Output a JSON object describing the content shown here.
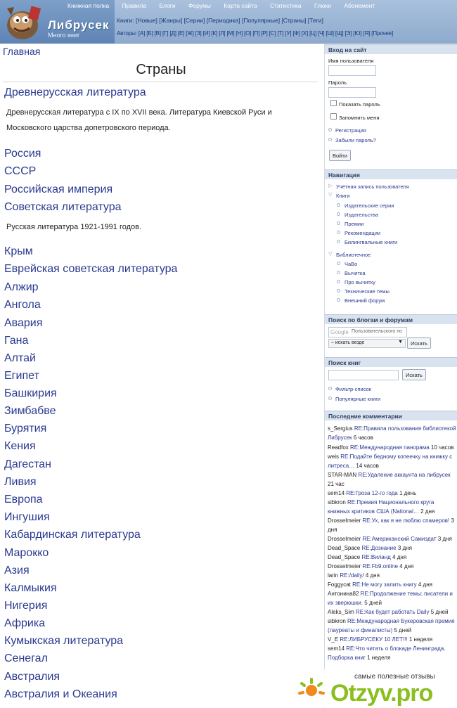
{
  "header": {
    "site_name": "Либрусек",
    "slogan": "Много книг",
    "primary_links": [
      "Книжная полка",
      "Правила",
      "Блоги",
      "Форумы",
      "Карта сайта",
      "Статистика",
      "Глюки",
      "Абонемент"
    ],
    "books_row": "Книги: [Новые] [Жанры] [Серии] [Периодика] [Популярные] [Страны] [Теги]",
    "authors_row": "Авторы: [А] [Б] [В] [Г] [Д] [Е] [Ж] [З] [И] [К] [Л] [М] [Н] [О] [П] [Р] [С] [Т] [У] [Ф] [Х] [Ц] [Ч] [Ш] [Щ] [Э] [Ю] [Я] [Прочее]"
  },
  "main": {
    "breadcrumb": "Главная",
    "title": "Страны",
    "items": [
      {
        "name": "Древнерусская литература"
      },
      {
        "desc": "Древнерусская литература с IX по XVII века. Литература Киевской Руси и Московского царства допетровского периода."
      },
      {
        "name": "Россия"
      },
      {
        "name": "СССР"
      },
      {
        "name": "Российская империя"
      },
      {
        "name": "Советская литература"
      },
      {
        "desc": "Русская литература 1921-1991 годов."
      },
      {
        "name": "Крым"
      },
      {
        "name": "Еврейская советская литература"
      },
      {
        "name": "Алжир"
      },
      {
        "name": "Ангола"
      },
      {
        "name": "Авария"
      },
      {
        "name": "Гана"
      },
      {
        "name": "Алтай"
      },
      {
        "name": "Египет"
      },
      {
        "name": "Башкирия"
      },
      {
        "name": "Зимбабве"
      },
      {
        "name": "Бурятия"
      },
      {
        "name": "Кения"
      },
      {
        "name": "Дагестан"
      },
      {
        "name": "Ливия"
      },
      {
        "name": "Европа"
      },
      {
        "name": "Ингушия"
      },
      {
        "name": "Кабардинская литература"
      },
      {
        "name": "Марокко"
      },
      {
        "name": "Азия"
      },
      {
        "name": "Калмыкия"
      },
      {
        "name": "Нигерия"
      },
      {
        "name": "Африка"
      },
      {
        "name": "Кумыкская литература"
      },
      {
        "name": "Сенегал"
      },
      {
        "name": "Австралия"
      },
      {
        "name": "Австралия и Океания"
      }
    ]
  },
  "sidebar": {
    "login": {
      "heading": "Вход на сайт",
      "username_label": "Имя пользователя",
      "password_label": "Пароль",
      "show_password": "Показать пароль",
      "remember_me": "Запомнить меня",
      "register": "Регистрация",
      "forgot": "Забыли пароль?",
      "submit": "Войти"
    },
    "navigation": {
      "heading": "Навигация",
      "account": "Учётная запись пользователя",
      "books": "Книги",
      "books_children": [
        "Издательские серии",
        "Издательства",
        "Премии",
        "Рекомендации",
        "Билингвальные книги"
      ],
      "library": "Библиотечное",
      "library_children": [
        "ЧаВо",
        "Вычитка",
        "Про вычитку",
        "Технические темы",
        "Внешний форум"
      ]
    },
    "blog_search": {
      "heading": "Поиск по блогам и форумам",
      "google_label": "Google",
      "placeholder": "Пользовательского по",
      "scope": "– искать везде",
      "submit": "Искать"
    },
    "book_search": {
      "heading": "Поиск книг",
      "submit": "Искать",
      "filter_list": "Фильтр-список",
      "popular": "Популярные книги"
    },
    "comments": {
      "heading": "Последние комментарии",
      "items": [
        {
          "user": "s_Sergius",
          "link": "RE:Правила пользования библиотекой Либрусек",
          "time": "6 часов"
        },
        {
          "user": "Readfox",
          "link": "RE:Международная панорама",
          "time": "10 часов"
        },
        {
          "user": "weis",
          "link": "RE:Подайте бедному копеечку на книжку с литреса…",
          "time": "14 часов"
        },
        {
          "user": "STAR-MAN",
          "link": "RE:Удаление аккаунта на либрусек",
          "time": "21 час"
        },
        {
          "user": "sem14",
          "link": "RE:Гроза 12-го года",
          "time": "1 день"
        },
        {
          "user": "sibkron",
          "link": "RE:Премия Национального круга книжных критиков США (National…",
          "time": "2 дня"
        },
        {
          "user": "Drosselmeier",
          "link": "RE:Ух, как я не люблю спамеров!",
          "time": "3 дня"
        },
        {
          "user": "Drosselmeier",
          "link": "RE:Американский Самиздат",
          "time": "3 дня"
        },
        {
          "user": "Dead_Space",
          "link": "RE:Дознание",
          "time": "3 дня"
        },
        {
          "user": "Dead_Space",
          "link": "RE:Виланд",
          "time": "4 дня"
        },
        {
          "user": "Drosselmeier",
          "link": "RE:Fb9.online",
          "time": "4 дня"
        },
        {
          "user": "larin",
          "link": "RE:/daily/",
          "time": "4 дня"
        },
        {
          "user": "Foggycat",
          "link": "RE:Не могу залить книгу",
          "time": "4 дня"
        },
        {
          "user": "Антонина82",
          "link": "RE:Продолжение темы: писатели и их зверюшки.",
          "time": "5 дней"
        },
        {
          "user": "Aleks_Sim",
          "link": "RE:Как будет работать Daily",
          "time": "5 дней"
        },
        {
          "user": "sibkron",
          "link": "RE:Международная Букеровская премия (лауреаты и финалисты)",
          "time": "5 дней"
        },
        {
          "user": "V_E",
          "link": "RE:ЛИБРУСЕКУ 10 ЛЕТ!!!",
          "time": "1 неделя"
        },
        {
          "user": "sem14",
          "link": "RE:Что читать о блокаде Ленинграда. Подборка книг",
          "time": "1 неделя"
        }
      ]
    }
  },
  "watermark": {
    "tagline": "самые полезные отзывы",
    "logo": "Otzyv.pro"
  }
}
